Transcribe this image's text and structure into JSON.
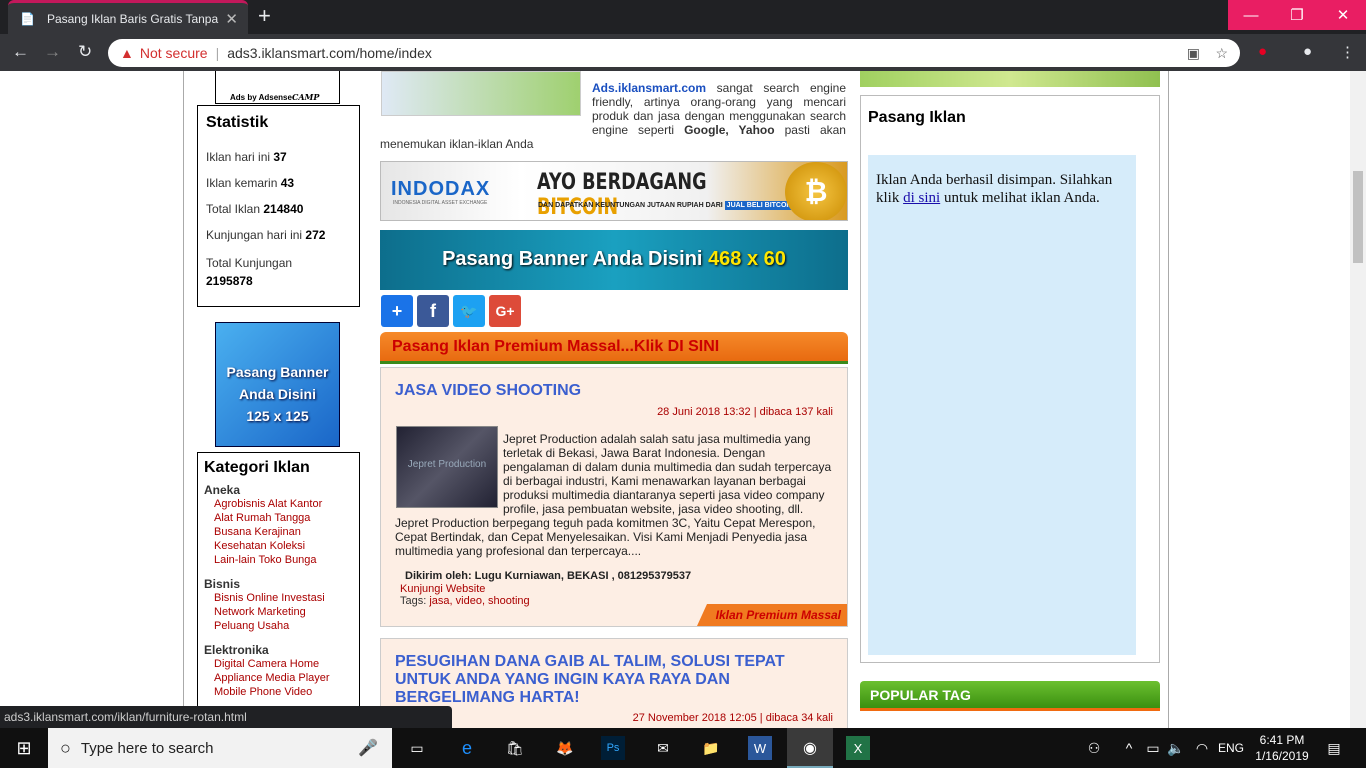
{
  "browser": {
    "tab_title": "Pasang Iklan Baris Gratis Tanpa D",
    "not_secure": "Not secure",
    "url": "ads3.iklansmart.com/home/index",
    "status_url": "ads3.iklansmart.com/iklan/furniture-rotan.html"
  },
  "left": {
    "ads_by": "Ads by Adsense",
    "ads_camp": "CAMP",
    "stat_title": "Statistik",
    "stats": [
      {
        "label": "Iklan hari ini ",
        "value": "37"
      },
      {
        "label": "Iklan kemarin ",
        "value": "43"
      },
      {
        "label": "Total Iklan ",
        "value": "214840"
      },
      {
        "label": "Kunjungan hari ini ",
        "value": "272"
      },
      {
        "label": "Total Kunjungan ",
        "value": "2195878"
      }
    ],
    "banner125": {
      "l1": "Pasang Banner",
      "l2": "Anda Disini",
      "l3": "125 x 125"
    },
    "kat_title": "Kategori Iklan",
    "kat": [
      {
        "g": "Aneka",
        "l1": "Agrobisnis   Alat Kantor",
        "l2": "Alat Rumah Tangga",
        "l3": "Busana   Kerajinan",
        "l4": "Kesehatan   Koleksi",
        "l5": "Lain-lain   Toko Bunga"
      },
      {
        "g": "Bisnis",
        "l1": "Bisnis Online   Investasi",
        "l2": "Network Marketing",
        "l3": "Peluang Usaha"
      },
      {
        "g": "Elektronika",
        "l1": "Digital Camera   Home",
        "l2": "Appliance   Media Player",
        "l3": "Mobile Phone   Video"
      }
    ]
  },
  "center": {
    "ads_brand": "Ads.iklansmart.com",
    "ads_text": " sangat search engine friendly, artinya orang-orang yang mencari produk dan jasa dengan menggunakan search engine seperti ",
    "google": "Google, Yahoo",
    "ads_tail": " pasti akan menemukan iklan-iklan Anda",
    "indodax": "INDODAX",
    "indodax_sub": "INDONESIA DIGITAL ASSET EXCHANGE",
    "bitcoin1": "AYO BERDAGANG ",
    "bitcoin2": "BITCOIN",
    "bitcoin_sub": "DAN DAPATKAN KEUNTUNGAN JUTAAN RUPIAH DARI",
    "bitcoin_btn": "JUAL BELI BITCOIN",
    "banner468_a": "Pasang Banner Anda Disini ",
    "banner468_b": "468 x 60",
    "premium_bar": "Pasang Iklan Premium Massal...Klik DI SINI",
    "card1": {
      "title": "JASA VIDEO SHOOTING",
      "meta": "28 Juni 2018 13:32 | dibaca 137 kali",
      "text1": "Jepret Production adalah salah satu jasa multimedia yang terletak di Bekasi, Jawa Barat Indonesia. Dengan pengalaman di dalam dunia multimedia dan sudah terpercaya di berbagai industri, Kami menawarkan layanan berbagai produksi multimedia diantaranya seperti jasa video company profile, jasa pembuatan website, jasa video shooting, dll.",
      "text2": "Jepret Production berpegang teguh pada komitmen 3C, Yaitu Cepat Merespon, Cepat Bertindak, dan Cepat Menyelesaikan. Visi Kami Menjadi Penyedia jasa multimedia yang profesional dan terpercaya....",
      "poster": "Dikirim oleh: Lugu Kurniawan, BEKASI , 081295379537",
      "website": "Kunjungi Website",
      "tags_label": "Tags: ",
      "tags": "jasa, video, shooting",
      "badge": "Iklan Premium Massal",
      "thumb": "Jepret Production"
    },
    "card2": {
      "title": "PESUGIHAN DANA GAIB AL TALIM, SOLUSI TEPAT UNTUK ANDA YANG INGIN KAYA RAYA DAN BERGELIMANG HARTA!",
      "meta": "27 November 2018 12:05 | dibaca 34 kali"
    }
  },
  "right": {
    "pasang_title": "Pasang Iklan",
    "msg1": "Iklan Anda berhasil disimpan. Silahkan klik ",
    "msg_link": "di sini",
    "msg2": " untuk melihat iklan Anda.",
    "popular": "POPULAR TAG"
  },
  "taskbar": {
    "search": "Type here to search",
    "time": "6:41 PM",
    "date": "1/16/2019",
    "lang": "ENG"
  }
}
